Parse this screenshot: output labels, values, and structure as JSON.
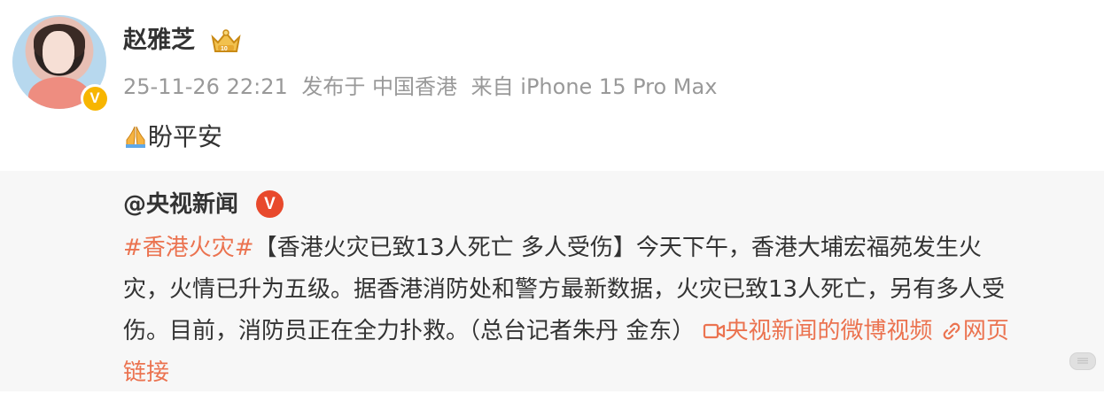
{
  "post": {
    "author": "赵雅芝",
    "timestamp": "25-11-26 22:21",
    "published_at": "发布于 中国香港",
    "source": "来自 iPhone 15 Pro Max",
    "text": "盼平安",
    "icons": {
      "verified_badge": "verified-yellow-v-icon",
      "member_crown": "crown-icon",
      "emoji": "praying-hands-emoji"
    }
  },
  "repost": {
    "author": "@央视新闻",
    "hashtag": "#香港火灾#",
    "line1_rest": "【香港火灾已致13人死亡 多人受伤】今天下午，香港大埔宏福苑发生火",
    "line2": "灾，火情已升为五级。据香港消防处和警方最新数据，火灾已致13人死亡，另有多人受",
    "line3_text": "伤。目前，消防员正在全力扑救。（总台记者朱丹 金东）",
    "video_link": "央视新闻的微博视频",
    "web_link_part1": "网页",
    "web_link_part2": "链接",
    "icons": {
      "verified": "verified-red-v-icon",
      "video": "video-icon",
      "link": "link-icon"
    }
  },
  "colors": {
    "accent": "#eb7350",
    "meta_gray": "#999999",
    "repost_bg": "#f7f7f7"
  }
}
